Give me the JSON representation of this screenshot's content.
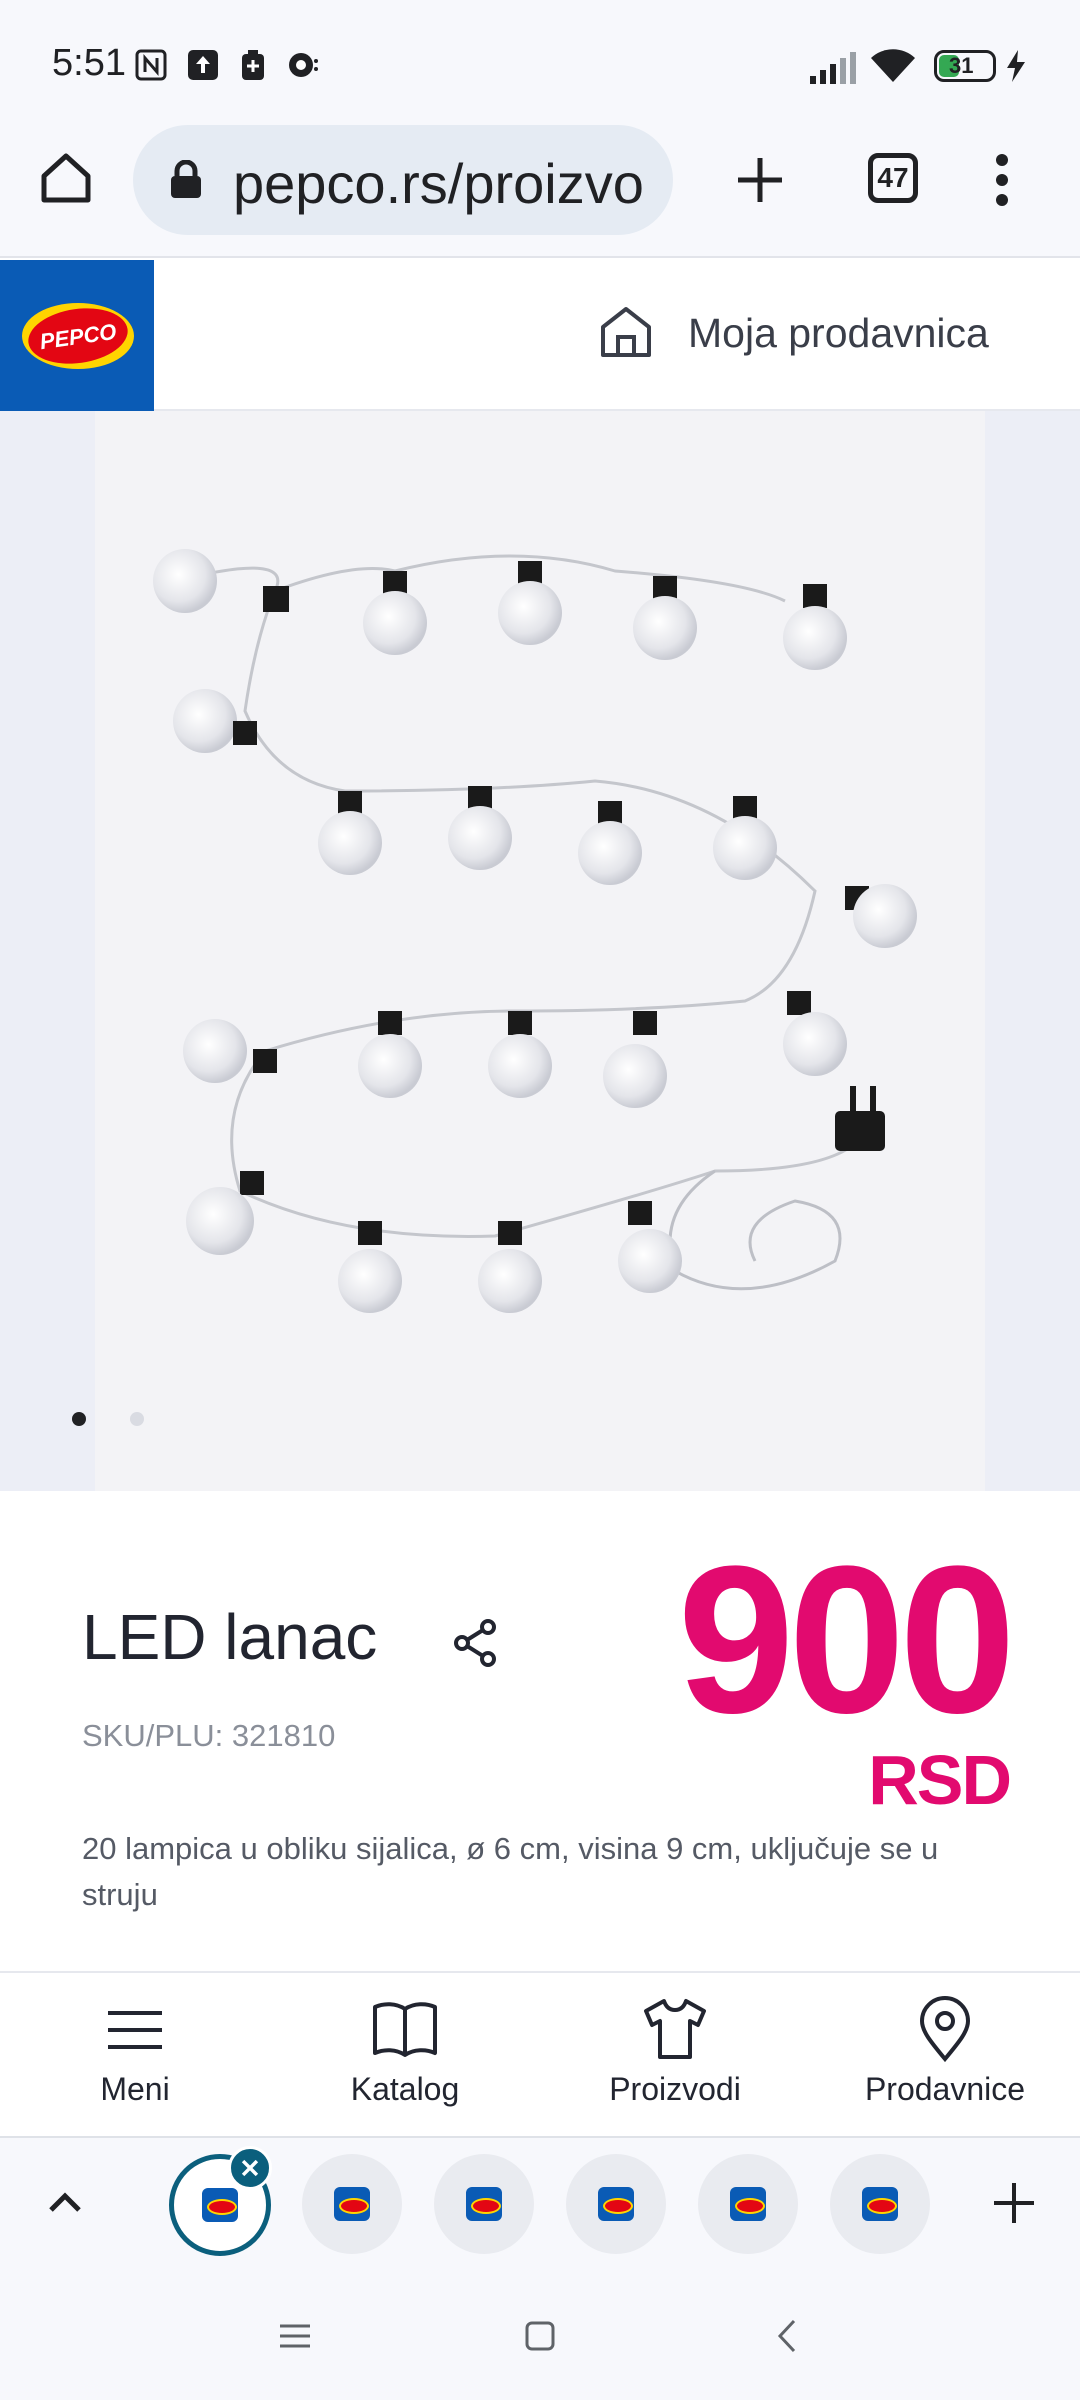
{
  "status_bar": {
    "time": "5:51",
    "battery": "31",
    "icons": [
      "nfc-icon",
      "upload-icon",
      "battery-saver-icon",
      "assistant-icon",
      "signal-icon",
      "wifi-icon",
      "battery-icon",
      "charging-icon"
    ]
  },
  "browser": {
    "url": "pepco.rs/proizvo",
    "tab_count": "47",
    "icons": [
      "home-icon",
      "lock-icon",
      "new-tab-icon",
      "tabs-icon",
      "menu-dots-icon"
    ]
  },
  "site_header": {
    "logo_text": "PEPCO",
    "store_label": "Moja prodavnica",
    "brand_color": "#0a5bb5"
  },
  "gallery": {
    "slide_count": 2,
    "active_slide": 1
  },
  "product": {
    "title": "LED lanac",
    "sku": "SKU/PLU: 321810",
    "price": "900",
    "currency": "RSD",
    "description": "20 lampica u obliku sijalica, ø 6 cm, visina 9 cm, uključuje se u struju",
    "price_color": "#e20a6f"
  },
  "site_nav": {
    "items": [
      {
        "label": "Meni",
        "icon": "hamburger-icon"
      },
      {
        "label": "Katalog",
        "icon": "book-icon"
      },
      {
        "label": "Proizvodi",
        "icon": "tshirt-icon"
      },
      {
        "label": "Prodavnice",
        "icon": "location-pin-icon"
      }
    ]
  },
  "tab_strip": {
    "open_tab_count": 6
  }
}
